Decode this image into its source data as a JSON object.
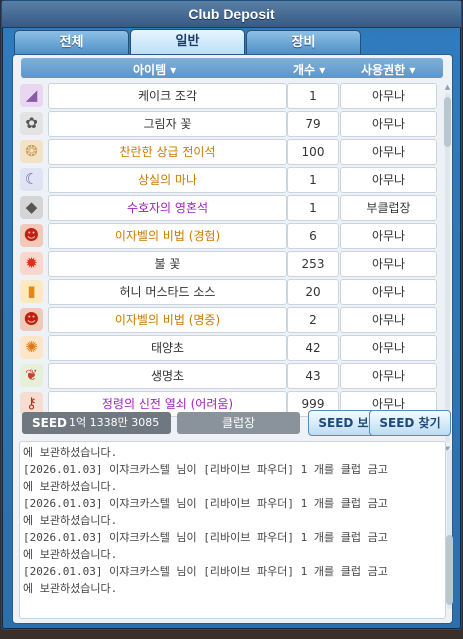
{
  "window": {
    "title": "Club Deposit"
  },
  "tabs": [
    {
      "label": "전체"
    },
    {
      "label": "일반"
    },
    {
      "label": "장비"
    }
  ],
  "columns": {
    "item": "아이템 ▾",
    "count": "개수 ▾",
    "permission": "사용권한 ▾"
  },
  "items": [
    {
      "name": "케이크 조각",
      "count": "1",
      "permission": "아무나",
      "name_color": "#333333",
      "icon": "cake-slice-icon",
      "icon_glyph": "◢",
      "icon_bg": "#e9d7f0",
      "icon_fg": "#8a5aa8"
    },
    {
      "name": "그림자 꽃",
      "count": "79",
      "permission": "아무나",
      "name_color": "#333333",
      "icon": "shadow-flower-icon",
      "icon_glyph": "✿",
      "icon_bg": "#e3e3e3",
      "icon_fg": "#555555"
    },
    {
      "name": "찬란한 상급 전이석",
      "count": "100",
      "permission": "아무나",
      "name_color": "#c87a00",
      "icon": "transfer-stone-icon",
      "icon_glyph": "❂",
      "icon_bg": "#f3e3c6",
      "icon_fg": "#c8a060"
    },
    {
      "name": "상실의 마나",
      "count": "1",
      "permission": "아무나",
      "name_color": "#c87a00",
      "icon": "moon-mana-icon",
      "icon_glyph": "☾",
      "icon_bg": "#dfe3f4",
      "icon_fg": "#6670a8"
    },
    {
      "name": "수호자의 영혼석",
      "count": "1",
      "permission": "부클럽장",
      "name_color": "#a020c0",
      "icon": "soul-stone-icon",
      "icon_glyph": "◆",
      "icon_bg": "#d5d5d5",
      "icon_fg": "#555555"
    },
    {
      "name": "이자벨의 비법 (경험)",
      "count": "6",
      "permission": "아무나",
      "name_color": "#c87a00",
      "icon": "isabel-exp-icon",
      "icon_glyph": "☻",
      "icon_bg": "#f2c8b8",
      "icon_fg": "#c02010"
    },
    {
      "name": "불 꽃",
      "count": "253",
      "permission": "아무나",
      "name_color": "#333333",
      "icon": "fire-flower-icon",
      "icon_glyph": "✹",
      "icon_bg": "#fbd6cc",
      "icon_fg": "#e0301a"
    },
    {
      "name": "허니 머스타드 소스",
      "count": "20",
      "permission": "아무나",
      "name_color": "#333333",
      "icon": "sauce-bottle-icon",
      "icon_glyph": "▮",
      "icon_bg": "#fde8c0",
      "icon_fg": "#e08a10"
    },
    {
      "name": "이자벨의 비법 (명중)",
      "count": "2",
      "permission": "아무나",
      "name_color": "#c87a00",
      "icon": "isabel-accuracy-icon",
      "icon_glyph": "☻",
      "icon_bg": "#f2c8b8",
      "icon_fg": "#c02010"
    },
    {
      "name": "태양초",
      "count": "42",
      "permission": "아무나",
      "name_color": "#333333",
      "icon": "sun-herb-icon",
      "icon_glyph": "✺",
      "icon_bg": "#fde6c8",
      "icon_fg": "#e07a10"
    },
    {
      "name": "생명초",
      "count": "43",
      "permission": "아무나",
      "name_color": "#333333",
      "icon": "life-herb-icon",
      "icon_glyph": "❦",
      "icon_bg": "#e6f0d8",
      "icon_fg": "#c84030"
    },
    {
      "name": "정령의 신전 열쇠 (어려움)",
      "count": "999",
      "permission": "아무나",
      "name_color": "#a020c0",
      "icon": "spirit-key-icon",
      "icon_glyph": "⚷",
      "icon_bg": "#f5ddd2",
      "icon_fg": "#b03020"
    }
  ],
  "seed": {
    "label": "SEED",
    "value": "1억 1338만 3085"
  },
  "buttons": {
    "club_master": "클럽장",
    "seed_deposit": "SEED 보관",
    "seed_withdraw": "SEED 찾기"
  },
  "log": [
    "에 보관하셨습니다.",
    "[2026.01.03] 이쟈크카스텔 님이 [리바이브 파우더] 1 개를 클럽 금고",
    "에 보관하셨습니다.",
    "[2026.01.03] 이쟈크카스텔 님이 [리바이브 파우더] 1 개를 클럽 금고",
    "에 보관하셨습니다.",
    "[2026.01.03] 이쟈크카스텔 님이 [리바이브 파우더] 1 개를 클럽 금고",
    "에 보관하셨습니다.",
    "[2026.01.03] 이쟈크카스텔 님이 [리바이브 파우더] 1 개를 클럽 금고",
    "에 보관하셨습니다."
  ]
}
